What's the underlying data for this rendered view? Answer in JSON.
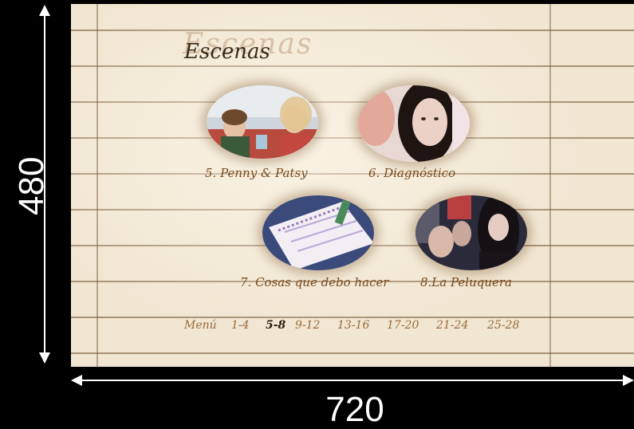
{
  "dimensions": {
    "height_label": "480",
    "width_label": "720"
  },
  "menu": {
    "title": "Escenas",
    "scenes": [
      {
        "caption": "5. Penny & Patsy"
      },
      {
        "caption": "6. Diagnóstico"
      },
      {
        "caption": "7. Cosas que debo hacer"
      },
      {
        "caption": "8.La Peluquera"
      }
    ],
    "nav": {
      "menu": "Menú",
      "ranges": [
        "1-4",
        "5-8",
        "9-12",
        "13-16",
        "17-20",
        "21-24",
        "25-28"
      ],
      "active": "5-8"
    }
  }
}
